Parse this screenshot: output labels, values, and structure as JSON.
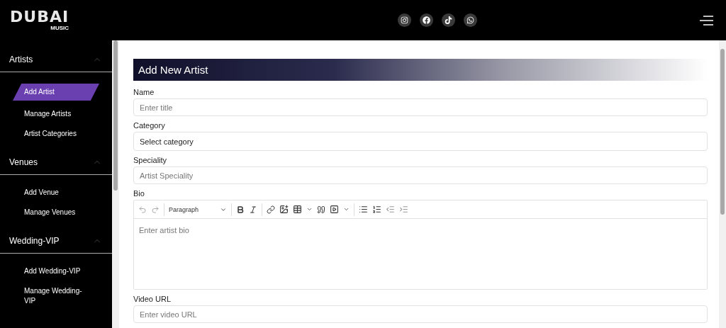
{
  "header": {
    "logo": {
      "word": "DUBAI",
      "sub": "MUSIC"
    }
  },
  "sidebar": {
    "sections": [
      {
        "title": "Artists",
        "expanded": true,
        "items": [
          {
            "label": "Add Artist",
            "selected": true
          },
          {
            "label": "Manage Artists",
            "selected": false
          },
          {
            "label": "Artist Categories",
            "selected": false
          }
        ]
      },
      {
        "title": "Venues",
        "expanded": true,
        "items": [
          {
            "label": "Add Venue",
            "selected": false
          },
          {
            "label": "Manage Venues",
            "selected": false
          }
        ]
      },
      {
        "title": "Wedding-VIP",
        "expanded": true,
        "items": [
          {
            "label": "Add Wedding-VIP",
            "selected": false
          },
          {
            "label": "Manage Wedding-VIP",
            "selected": false
          }
        ]
      }
    ]
  },
  "form": {
    "title": "Add New Artist",
    "fields": [
      {
        "kind": "input",
        "label": "Name",
        "placeholder": "Enter title"
      },
      {
        "kind": "select",
        "label": "Category",
        "value": "Select category"
      },
      {
        "kind": "input",
        "label": "Speciality",
        "placeholder": "Artist Speciality"
      },
      {
        "kind": "editor",
        "label": "Bio",
        "format": "Paragraph",
        "placeholder": "Enter artist bio"
      },
      {
        "kind": "input",
        "label": "Video URL",
        "placeholder": "Enter video URL"
      }
    ]
  }
}
